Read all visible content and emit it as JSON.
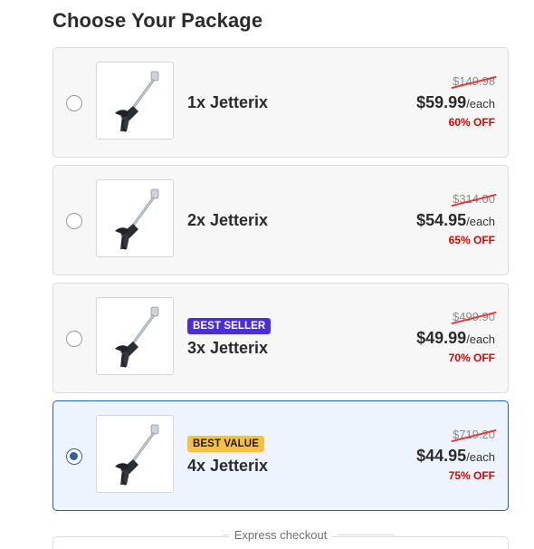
{
  "header": {
    "title": "Choose Your Package"
  },
  "packages": [
    {
      "name": "1x Jetterix",
      "badge": "",
      "old_price": "$149.98",
      "price": "$59.99",
      "unit": "/each",
      "discount": "60% OFF",
      "selected": false
    },
    {
      "name": "2x Jetterix",
      "badge": "",
      "old_price": "$314.00",
      "price": "$54.95",
      "unit": "/each",
      "discount": "65% OFF",
      "selected": false
    },
    {
      "name": "3x Jetterix",
      "badge": "BEST SELLER",
      "old_price": "$499.90",
      "price": "$49.99",
      "unit": "/each",
      "discount": "70% OFF",
      "selected": false
    },
    {
      "name": "4x Jetterix",
      "badge": "BEST VALUE",
      "old_price": "$719.20",
      "price": "$44.95",
      "unit": "/each",
      "discount": "75% OFF",
      "selected": true
    }
  ],
  "express": {
    "label": "Express checkout"
  },
  "colors": {
    "selected_border": "#2f5f9e",
    "selected_bg": "#eef4fd",
    "discount": "#e00000",
    "best_seller": "#4a2ddb",
    "best_value": "#f5c23e"
  },
  "icons": {
    "product_image": "pressure-washer-wand-icon"
  }
}
